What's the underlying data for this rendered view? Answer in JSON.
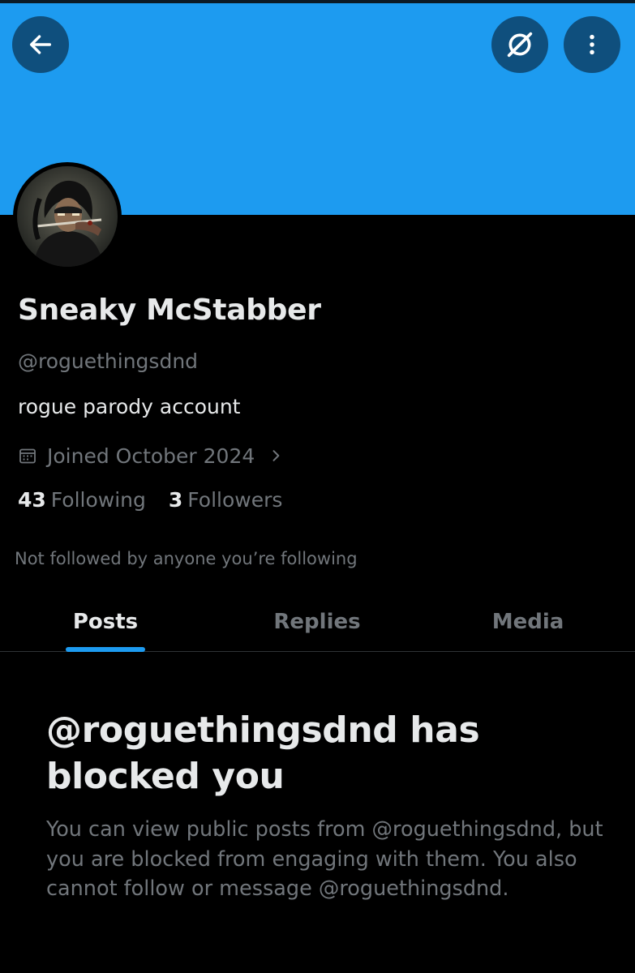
{
  "colors": {
    "banner": "#1d9bf0",
    "button_bg": "#0f4f7d",
    "background": "#000000",
    "primary_text": "#e7e9ea",
    "secondary_text": "#71767b",
    "accent": "#1d9bf0"
  },
  "header": {
    "back_icon": "arrow-left-icon",
    "grok_icon": "grok-slash-icon",
    "more_icon": "more-vertical-icon"
  },
  "profile": {
    "display_name": "Sneaky McStabber",
    "handle": "@roguethingsdnd",
    "bio": "rogue parody account",
    "joined": "Joined October 2024",
    "following_count": "43",
    "following_label": "Following",
    "followers_count": "3",
    "followers_label": "Followers",
    "not_followed_text": "Not followed by anyone you’re following"
  },
  "tabs": [
    {
      "label": "Posts",
      "active": true
    },
    {
      "label": "Replies",
      "active": false
    },
    {
      "label": "Media",
      "active": false
    }
  ],
  "blocked_notice": {
    "title": "@roguethingsdnd has blocked you",
    "description": "You can view public posts from @roguethingsdnd, but you are blocked from engaging with them. You also cannot follow or message @roguethingsdnd."
  }
}
